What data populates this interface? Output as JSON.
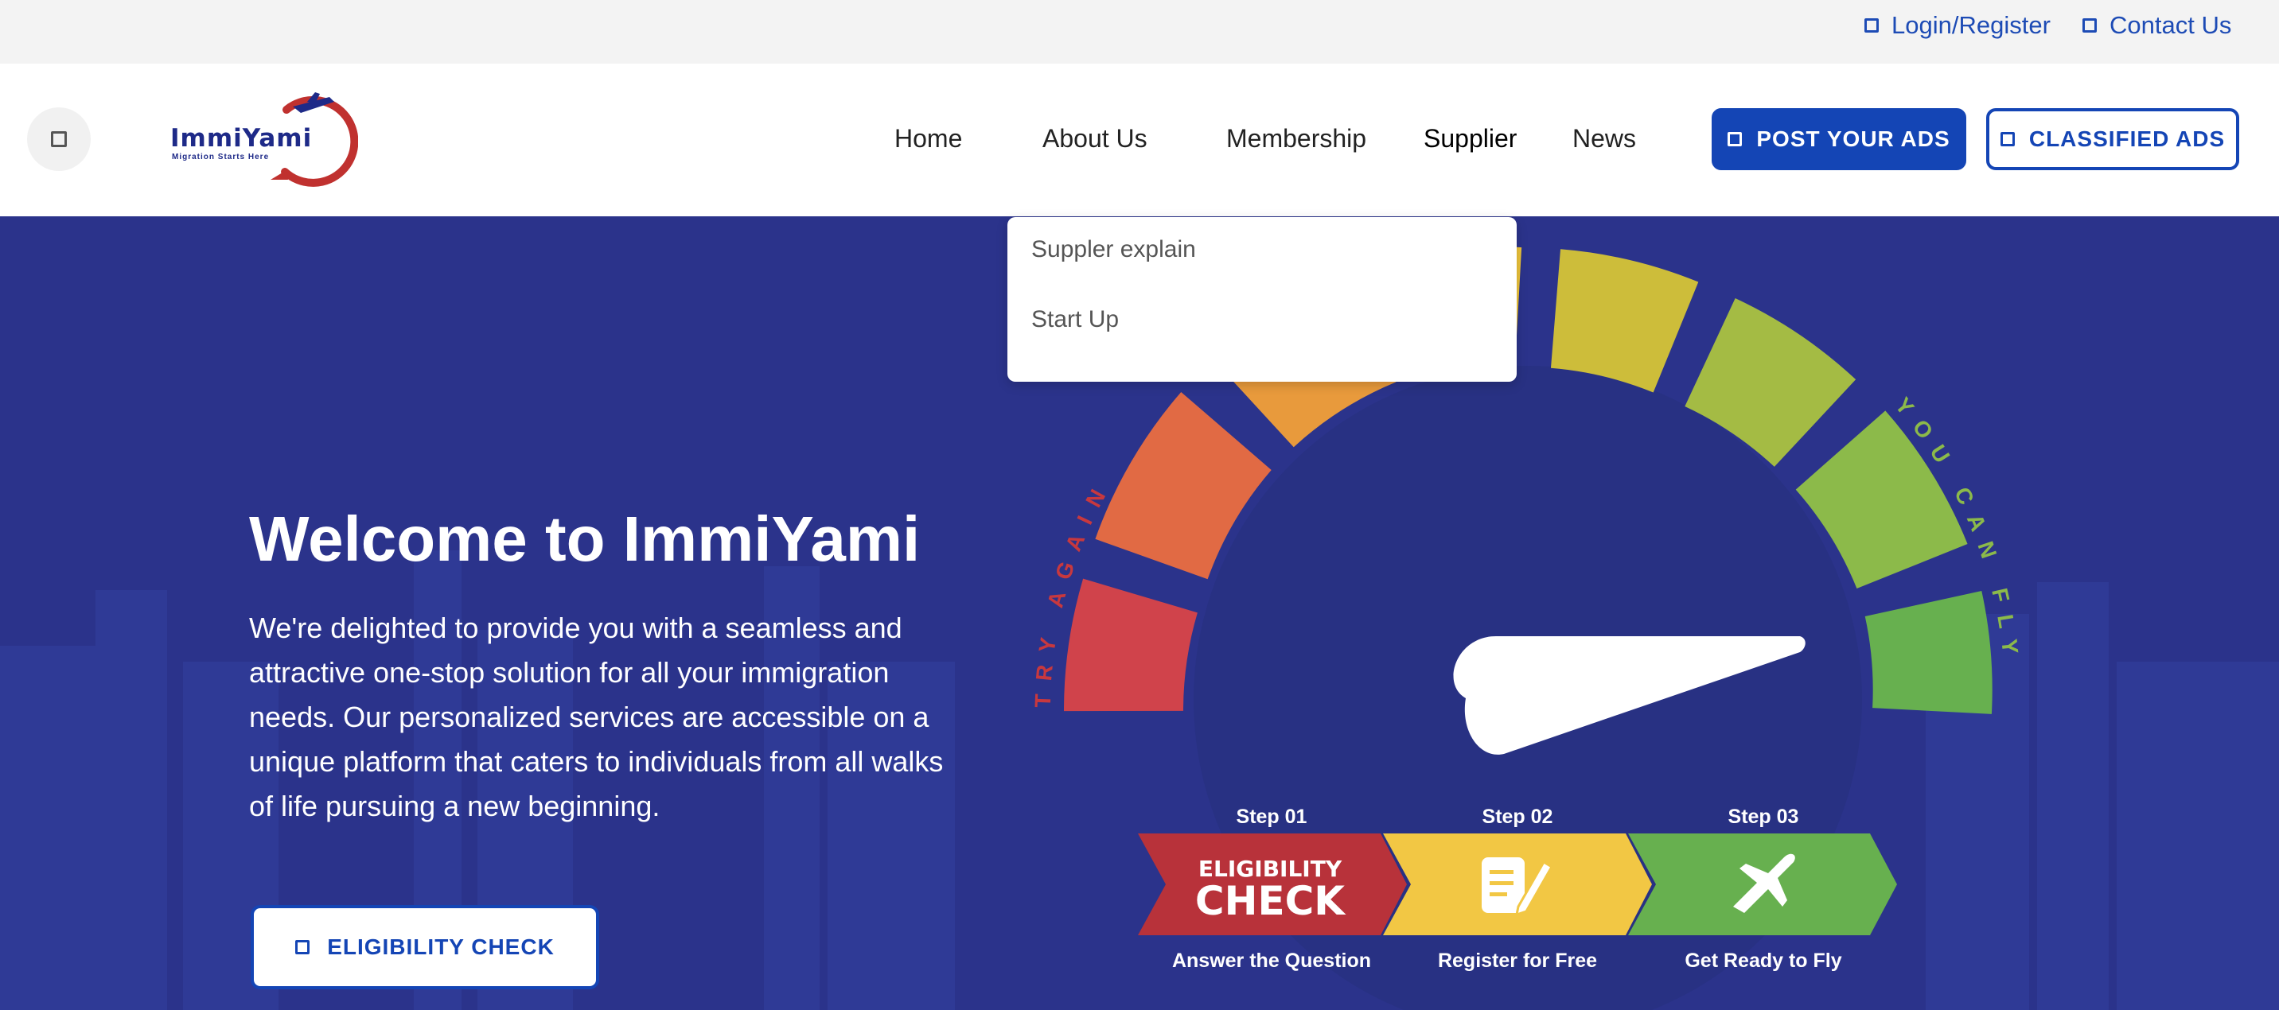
{
  "topbar": {
    "login_label": "Login/Register",
    "contact_label": "Contact Us"
  },
  "logo": {
    "name": "ImmiYami",
    "tagline": "Migration Starts Here"
  },
  "nav": {
    "items": [
      "Home",
      "About Us",
      "Membership",
      "Supplier",
      "News"
    ],
    "post_ads_label": "POST YOUR ADS",
    "classified_ads_label": "CLASSIFIED ADS"
  },
  "dropdown": {
    "items": [
      "Suppler explain",
      "Start Up"
    ]
  },
  "hero": {
    "title": "Welcome to ImmiYami",
    "text": "We're delighted to provide you with a seamless and attractive one-stop solution for all your immigration needs. Our personalized services are accessible on a unique platform that caters to individuals from all walks of life pursuing a new beginning.",
    "eligibility_button": "ELIGIBILITY CHECK"
  },
  "graphic": {
    "try_again": "TRY AGAIN",
    "you_can_fly": "YOU CAN FLY",
    "steps": [
      {
        "step": "Step 01",
        "badge_top": "ELIGIBILITY",
        "badge_main": "CHECK",
        "caption": "Answer the Question",
        "icon": "eligibility-check-icon",
        "color": "#b8323a"
      },
      {
        "step": "Step 02",
        "caption": "Register for Free",
        "icon": "notepad-pen-icon",
        "color": "#f2c744"
      },
      {
        "step": "Step 03",
        "caption": "Get Ready to Fly",
        "icon": "airplane-icon",
        "color": "#67b04f"
      }
    ]
  },
  "colors": {
    "brand_blue": "#1445b5",
    "hero_bg": "#2b338b",
    "logo_red": "#c0312f"
  }
}
